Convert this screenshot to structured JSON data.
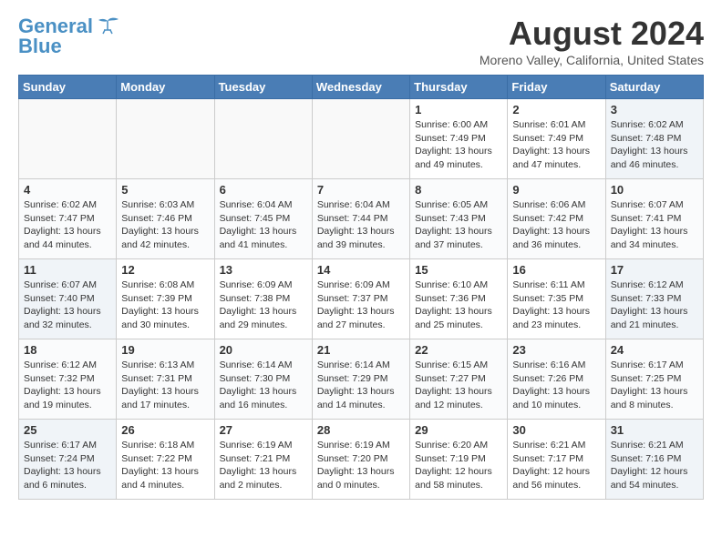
{
  "header": {
    "logo_line1": "General",
    "logo_line2": "Blue",
    "month_title": "August 2024",
    "location": "Moreno Valley, California, United States"
  },
  "weekdays": [
    "Sunday",
    "Monday",
    "Tuesday",
    "Wednesday",
    "Thursday",
    "Friday",
    "Saturday"
  ],
  "weeks": [
    [
      {
        "day": "",
        "info": ""
      },
      {
        "day": "",
        "info": ""
      },
      {
        "day": "",
        "info": ""
      },
      {
        "day": "",
        "info": ""
      },
      {
        "day": "1",
        "info": "Sunrise: 6:00 AM\nSunset: 7:49 PM\nDaylight: 13 hours\nand 49 minutes."
      },
      {
        "day": "2",
        "info": "Sunrise: 6:01 AM\nSunset: 7:49 PM\nDaylight: 13 hours\nand 47 minutes."
      },
      {
        "day": "3",
        "info": "Sunrise: 6:02 AM\nSunset: 7:48 PM\nDaylight: 13 hours\nand 46 minutes."
      }
    ],
    [
      {
        "day": "4",
        "info": "Sunrise: 6:02 AM\nSunset: 7:47 PM\nDaylight: 13 hours\nand 44 minutes."
      },
      {
        "day": "5",
        "info": "Sunrise: 6:03 AM\nSunset: 7:46 PM\nDaylight: 13 hours\nand 42 minutes."
      },
      {
        "day": "6",
        "info": "Sunrise: 6:04 AM\nSunset: 7:45 PM\nDaylight: 13 hours\nand 41 minutes."
      },
      {
        "day": "7",
        "info": "Sunrise: 6:04 AM\nSunset: 7:44 PM\nDaylight: 13 hours\nand 39 minutes."
      },
      {
        "day": "8",
        "info": "Sunrise: 6:05 AM\nSunset: 7:43 PM\nDaylight: 13 hours\nand 37 minutes."
      },
      {
        "day": "9",
        "info": "Sunrise: 6:06 AM\nSunset: 7:42 PM\nDaylight: 13 hours\nand 36 minutes."
      },
      {
        "day": "10",
        "info": "Sunrise: 6:07 AM\nSunset: 7:41 PM\nDaylight: 13 hours\nand 34 minutes."
      }
    ],
    [
      {
        "day": "11",
        "info": "Sunrise: 6:07 AM\nSunset: 7:40 PM\nDaylight: 13 hours\nand 32 minutes."
      },
      {
        "day": "12",
        "info": "Sunrise: 6:08 AM\nSunset: 7:39 PM\nDaylight: 13 hours\nand 30 minutes."
      },
      {
        "day": "13",
        "info": "Sunrise: 6:09 AM\nSunset: 7:38 PM\nDaylight: 13 hours\nand 29 minutes."
      },
      {
        "day": "14",
        "info": "Sunrise: 6:09 AM\nSunset: 7:37 PM\nDaylight: 13 hours\nand 27 minutes."
      },
      {
        "day": "15",
        "info": "Sunrise: 6:10 AM\nSunset: 7:36 PM\nDaylight: 13 hours\nand 25 minutes."
      },
      {
        "day": "16",
        "info": "Sunrise: 6:11 AM\nSunset: 7:35 PM\nDaylight: 13 hours\nand 23 minutes."
      },
      {
        "day": "17",
        "info": "Sunrise: 6:12 AM\nSunset: 7:33 PM\nDaylight: 13 hours\nand 21 minutes."
      }
    ],
    [
      {
        "day": "18",
        "info": "Sunrise: 6:12 AM\nSunset: 7:32 PM\nDaylight: 13 hours\nand 19 minutes."
      },
      {
        "day": "19",
        "info": "Sunrise: 6:13 AM\nSunset: 7:31 PM\nDaylight: 13 hours\nand 17 minutes."
      },
      {
        "day": "20",
        "info": "Sunrise: 6:14 AM\nSunset: 7:30 PM\nDaylight: 13 hours\nand 16 minutes."
      },
      {
        "day": "21",
        "info": "Sunrise: 6:14 AM\nSunset: 7:29 PM\nDaylight: 13 hours\nand 14 minutes."
      },
      {
        "day": "22",
        "info": "Sunrise: 6:15 AM\nSunset: 7:27 PM\nDaylight: 13 hours\nand 12 minutes."
      },
      {
        "day": "23",
        "info": "Sunrise: 6:16 AM\nSunset: 7:26 PM\nDaylight: 13 hours\nand 10 minutes."
      },
      {
        "day": "24",
        "info": "Sunrise: 6:17 AM\nSunset: 7:25 PM\nDaylight: 13 hours\nand 8 minutes."
      }
    ],
    [
      {
        "day": "25",
        "info": "Sunrise: 6:17 AM\nSunset: 7:24 PM\nDaylight: 13 hours\nand 6 minutes."
      },
      {
        "day": "26",
        "info": "Sunrise: 6:18 AM\nSunset: 7:22 PM\nDaylight: 13 hours\nand 4 minutes."
      },
      {
        "day": "27",
        "info": "Sunrise: 6:19 AM\nSunset: 7:21 PM\nDaylight: 13 hours\nand 2 minutes."
      },
      {
        "day": "28",
        "info": "Sunrise: 6:19 AM\nSunset: 7:20 PM\nDaylight: 13 hours\nand 0 minutes."
      },
      {
        "day": "29",
        "info": "Sunrise: 6:20 AM\nSunset: 7:19 PM\nDaylight: 12 hours\nand 58 minutes."
      },
      {
        "day": "30",
        "info": "Sunrise: 6:21 AM\nSunset: 7:17 PM\nDaylight: 12 hours\nand 56 minutes."
      },
      {
        "day": "31",
        "info": "Sunrise: 6:21 AM\nSunset: 7:16 PM\nDaylight: 12 hours\nand 54 minutes."
      }
    ]
  ]
}
